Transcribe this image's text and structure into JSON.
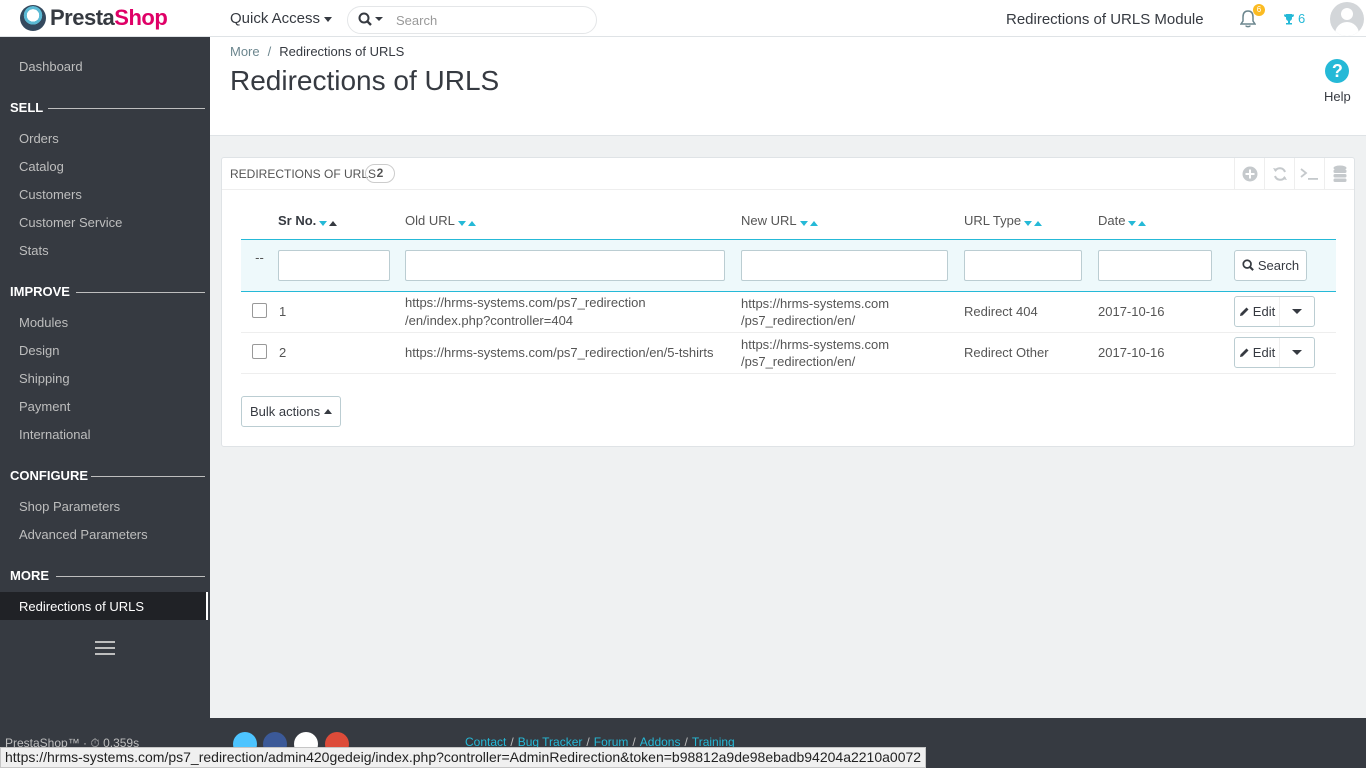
{
  "brand": {
    "part1": "Presta",
    "part2": "Shop"
  },
  "header": {
    "quick_access": "Quick Access",
    "search_placeholder": "Search",
    "module_title": "Redirections of URLS Module",
    "notifications_count": "6",
    "employees_count": "6"
  },
  "sidebar": {
    "dashboard": "Dashboard",
    "sections": [
      {
        "title": "SELL",
        "items": [
          "Orders",
          "Catalog",
          "Customers",
          "Customer Service",
          "Stats"
        ]
      },
      {
        "title": "IMPROVE",
        "items": [
          "Modules",
          "Design",
          "Shipping",
          "Payment",
          "International"
        ]
      },
      {
        "title": "CONFIGURE",
        "items": [
          "Shop Parameters",
          "Advanced Parameters"
        ]
      },
      {
        "title": "MORE",
        "items": [
          "Redirections of URLS"
        ]
      }
    ],
    "footer": "PrestaShop™ · ⏱ 0.359s"
  },
  "page": {
    "breadcrumb_parent": "More",
    "breadcrumb_sep": "/",
    "breadcrumb_current": "Redirections of URLS",
    "title": "Redirections of URLS",
    "help": "Help",
    "help_icon": "?"
  },
  "panel": {
    "title": "Redirections of URLS",
    "count": "2",
    "columns": [
      "Sr No.",
      "Old URL",
      "New URL",
      "URL Type",
      "Date"
    ],
    "filter_placeholder": "--",
    "search_button": "Search",
    "rows": [
      {
        "sr": "1",
        "old_url_1": "https://hrms-systems.com/ps7_redirection",
        "old_url_2": "/en/index.php?controller=404",
        "new_url_1": "https://hrms-systems.com",
        "new_url_2": "/ps7_redirection/en/",
        "type": "Redirect 404",
        "date": "2017-10-16",
        "edit": "Edit"
      },
      {
        "sr": "2",
        "old_url_1": "https://hrms-systems.com/ps7_redirection/en/5-tshirts",
        "old_url_2": "",
        "new_url_1": "https://hrms-systems.com",
        "new_url_2": "/ps7_redirection/en/",
        "type": "Redirect Other",
        "date": "2017-10-16",
        "edit": "Edit"
      }
    ],
    "bulk_actions": "Bulk actions"
  },
  "footer": {
    "links": [
      "Contact",
      "Bug Tracker",
      "Forum",
      "Addons",
      "Training"
    ],
    "separator": "/"
  },
  "status_url": "https://hrms-systems.com/ps7_redirection/admin420gedeig/index.php?controller=AdminRedirection&token=b98812a9de98ebadb94204a2210a0072",
  "colors": {
    "accent": "#25b9d7",
    "sidebar_bg": "#363a41",
    "brand_pink": "#df0067",
    "badge": "#fbbb22"
  }
}
